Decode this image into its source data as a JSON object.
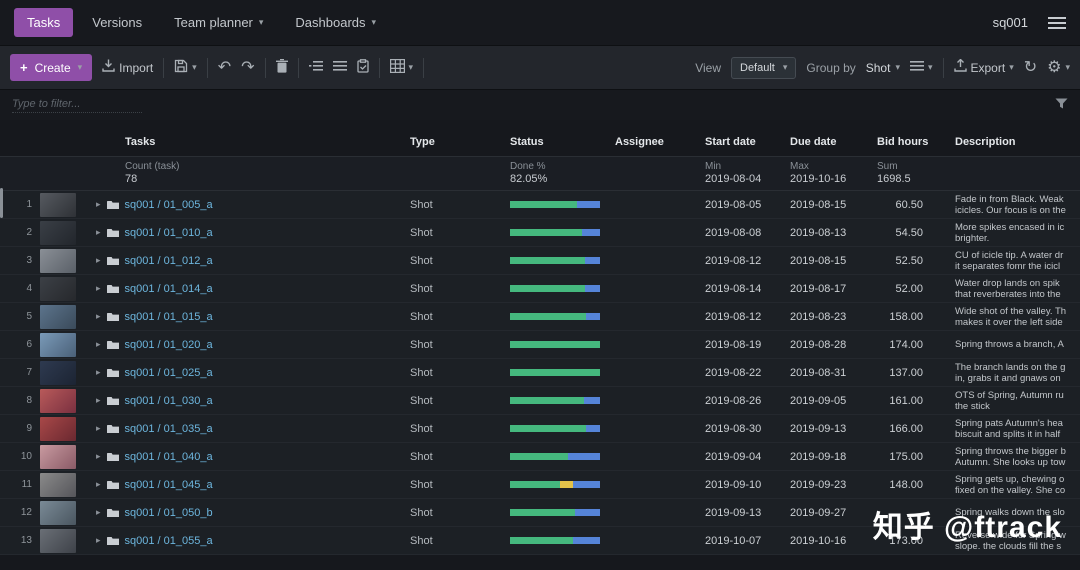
{
  "topnav": {
    "tabs": [
      {
        "label": "Tasks",
        "active": true
      },
      {
        "label": "Versions",
        "active": false
      },
      {
        "label": "Team planner",
        "active": false
      },
      {
        "label": "Dashboards",
        "active": false
      }
    ],
    "project": "sq001"
  },
  "icons": {
    "caret": "▾",
    "expand": "▸",
    "plus": "+",
    "undo": "↶",
    "redo": "↷",
    "refresh": "↻",
    "gear": "⚙"
  },
  "toolbar": {
    "create_label": "Create",
    "import_label": "Import",
    "view_label": "View",
    "view_value": "Default",
    "groupby_label": "Group by",
    "groupby_value": "Shot",
    "export_label": "Export"
  },
  "filter": {
    "placeholder": "Type to filter..."
  },
  "palette": {
    "green": "#45b87e",
    "blue": "#5584d8",
    "yellow": "#e2c24a",
    "accent": "#8f4fa8",
    "link": "#6db6de"
  },
  "table": {
    "columns": [
      "Tasks",
      "Type",
      "Status",
      "Assignee",
      "Start date",
      "Due date",
      "Bid hours",
      "Description"
    ],
    "summary": {
      "count_label": "Count (task)",
      "count_value": "78",
      "done_label": "Done %",
      "done_value": "82.05%",
      "min_label": "Min",
      "min_value": "2019-08-04",
      "max_label": "Max",
      "max_value": "2019-10-16",
      "sum_label": "Sum",
      "sum_value": "1698.5"
    },
    "rows": [
      {
        "num": "1",
        "name": "sq001 / 01_005_a",
        "type": "Shot",
        "progress": [
          [
            "green",
            74
          ],
          [
            "blue",
            26
          ]
        ],
        "start": "2019-08-05",
        "due": "2019-08-15",
        "bid": "60.50",
        "desc": "Fade in from Black. Weak\nicicles. Our focus is on the",
        "thumb": [
          "#565a60",
          "#2e3136"
        ]
      },
      {
        "num": "2",
        "name": "sq001 / 01_010_a",
        "type": "Shot",
        "progress": [
          [
            "green",
            80
          ],
          [
            "blue",
            20
          ]
        ],
        "start": "2019-08-08",
        "due": "2019-08-13",
        "bid": "54.50",
        "desc": "More spikes encased in ic\nbrighter.",
        "thumb": [
          "#3a3f46",
          "#22262c"
        ]
      },
      {
        "num": "3",
        "name": "sq001 / 01_012_a",
        "type": "Shot",
        "progress": [
          [
            "green",
            83
          ],
          [
            "blue",
            17
          ]
        ],
        "start": "2019-08-12",
        "due": "2019-08-15",
        "bid": "52.50",
        "desc": "CU of icicle tip. A water dr\nit separates fomr the icicl",
        "thumb": [
          "#8a8f96",
          "#5a6068"
        ]
      },
      {
        "num": "4",
        "name": "sq001 / 01_014_a",
        "type": "Shot",
        "progress": [
          [
            "green",
            83
          ],
          [
            "blue",
            17
          ]
        ],
        "start": "2019-08-14",
        "due": "2019-08-17",
        "bid": "52.00",
        "desc": "Water drop lands on spik\nthat reverberates into the",
        "thumb": [
          "#3c4046",
          "#26282c"
        ]
      },
      {
        "num": "5",
        "name": "sq001 / 01_015_a",
        "type": "Shot",
        "progress": [
          [
            "green",
            84
          ],
          [
            "blue",
            16
          ]
        ],
        "start": "2019-08-12",
        "due": "2019-08-23",
        "bid": "158.00",
        "desc": "Wide shot of the valley. Th\nmakes it over the left side",
        "thumb": [
          "#5c748c",
          "#3a4a5a"
        ]
      },
      {
        "num": "6",
        "name": "sq001 / 01_020_a",
        "type": "Shot",
        "progress": [
          [
            "green",
            100
          ]
        ],
        "start": "2019-08-19",
        "due": "2019-08-28",
        "bid": "174.00",
        "desc": "Spring throws a branch, A",
        "thumb": [
          "#7a9ab8",
          "#4a6078"
        ]
      },
      {
        "num": "7",
        "name": "sq001 / 01_025_a",
        "type": "Shot",
        "progress": [
          [
            "green",
            100
          ]
        ],
        "start": "2019-08-22",
        "due": "2019-08-31",
        "bid": "137.00",
        "desc": "The branch lands on the g\nin, grabs it and gnaws on",
        "thumb": [
          "#2e3a50",
          "#1c2433"
        ]
      },
      {
        "num": "8",
        "name": "sq001 / 01_030_a",
        "type": "Shot",
        "progress": [
          [
            "green",
            82
          ],
          [
            "blue",
            18
          ]
        ],
        "start": "2019-08-26",
        "due": "2019-09-05",
        "bid": "161.00",
        "desc": "OTS of Spring, Autumn ru\nthe stick",
        "thumb": [
          "#b85a5a",
          "#7a3040"
        ]
      },
      {
        "num": "9",
        "name": "sq001 / 01_035_a",
        "type": "Shot",
        "progress": [
          [
            "green",
            84
          ],
          [
            "blue",
            16
          ]
        ],
        "start": "2019-08-30",
        "due": "2019-09-13",
        "bid": "166.00",
        "desc": "Spring pats Autumn's hea\nbiscuit and splits it in half",
        "thumb": [
          "#a84848",
          "#6a2830"
        ]
      },
      {
        "num": "10",
        "name": "sq001 / 01_040_a",
        "type": "Shot",
        "progress": [
          [
            "green",
            64
          ],
          [
            "blue",
            36
          ]
        ],
        "start": "2019-09-04",
        "due": "2019-09-18",
        "bid": "175.00",
        "desc": "Spring throws the bigger b\nAutumn. She looks up tow",
        "thumb": [
          "#c89aa0",
          "#8a5a66"
        ]
      },
      {
        "num": "11",
        "name": "sq001 / 01_045_a",
        "type": "Shot",
        "progress": [
          [
            "green",
            56
          ],
          [
            "yellow",
            14
          ],
          [
            "blue",
            30
          ]
        ],
        "start": "2019-09-10",
        "due": "2019-09-23",
        "bid": "148.00",
        "desc": "Spring gets up, chewing o\nfixed on the valley. She co",
        "thumb": [
          "#8a8a8a",
          "#55555a"
        ]
      },
      {
        "num": "12",
        "name": "sq001 / 01_050_b",
        "type": "Shot",
        "progress": [
          [
            "green",
            72
          ],
          [
            "blue",
            28
          ]
        ],
        "start": "2019-09-13",
        "due": "2019-09-27",
        "bid": "",
        "desc": "Spring walks down the slo",
        "thumb": [
          "#7a8a96",
          "#4a5660"
        ]
      },
      {
        "num": "13",
        "name": "sq001 / 01_055_a",
        "type": "Shot",
        "progress": [
          [
            "green",
            70
          ],
          [
            "blue",
            30
          ]
        ],
        "start": "2019-10-07",
        "due": "2019-10-16",
        "bid": "173.00",
        "desc": "Reverse wide for Spring w\nslope. the clouds fill the s",
        "thumb": [
          "#6a6f76",
          "#3e4249"
        ]
      }
    ]
  },
  "watermark": {
    "text": "知乎 @ftrack"
  }
}
